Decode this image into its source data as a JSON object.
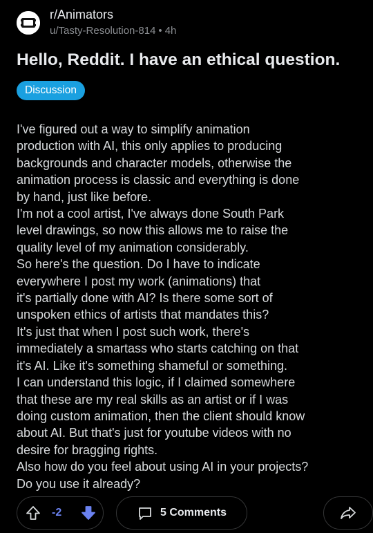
{
  "post": {
    "subreddit": "r/Animators",
    "author": "u/Tasty-Resolution-814",
    "separator": "•",
    "age": "4h",
    "title": "Hello, Reddit. I have an ethical question.",
    "flair": "Discussion",
    "body_lines": [
      "I've figured out a way to simplify animation",
      "production with AI, this only applies to producing",
      "backgrounds and character models, otherwise the",
      "animation process is classic and everything is done",
      "by hand, just like before.",
      "I'm not a cool artist, I've always done South Park",
      "level drawings, so now this allows me to raise the",
      "quality level of my animation considerably.",
      "So here's the question. Do I have to indicate",
      "everywhere I post my work (animations) that",
      "it's partially done with AI? Is there some sort of",
      "unspoken ethics of artists that mandates this?",
      "It's just that when I post such work, there's",
      "immediately a smartass who starts catching on that",
      "it's AI. Like it's something shameful or something.",
      "I can understand this logic, if I claimed somewhere",
      "that these are my real skills as an artist or if I was",
      "doing custom animation, then the client should know",
      "about AI. But that's just for youtube videos with no",
      "desire for bragging rights.",
      "Also how do you feel about using AI in your projects?",
      "Do you use it already?"
    ]
  },
  "actions": {
    "score": "-2",
    "comments_label": "5 Comments",
    "upvote_icon": "arrow-up-outline-icon",
    "downvote_icon": "arrow-down-filled-icon",
    "comment_icon": "speech-bubble-icon",
    "share_icon": "share-arrow-icon"
  },
  "colors": {
    "background": "#000000",
    "flair": "#1aa0e0",
    "downvote_active": "#6b82f0",
    "text": "#d7dadc",
    "meta": "#8a8d91"
  }
}
